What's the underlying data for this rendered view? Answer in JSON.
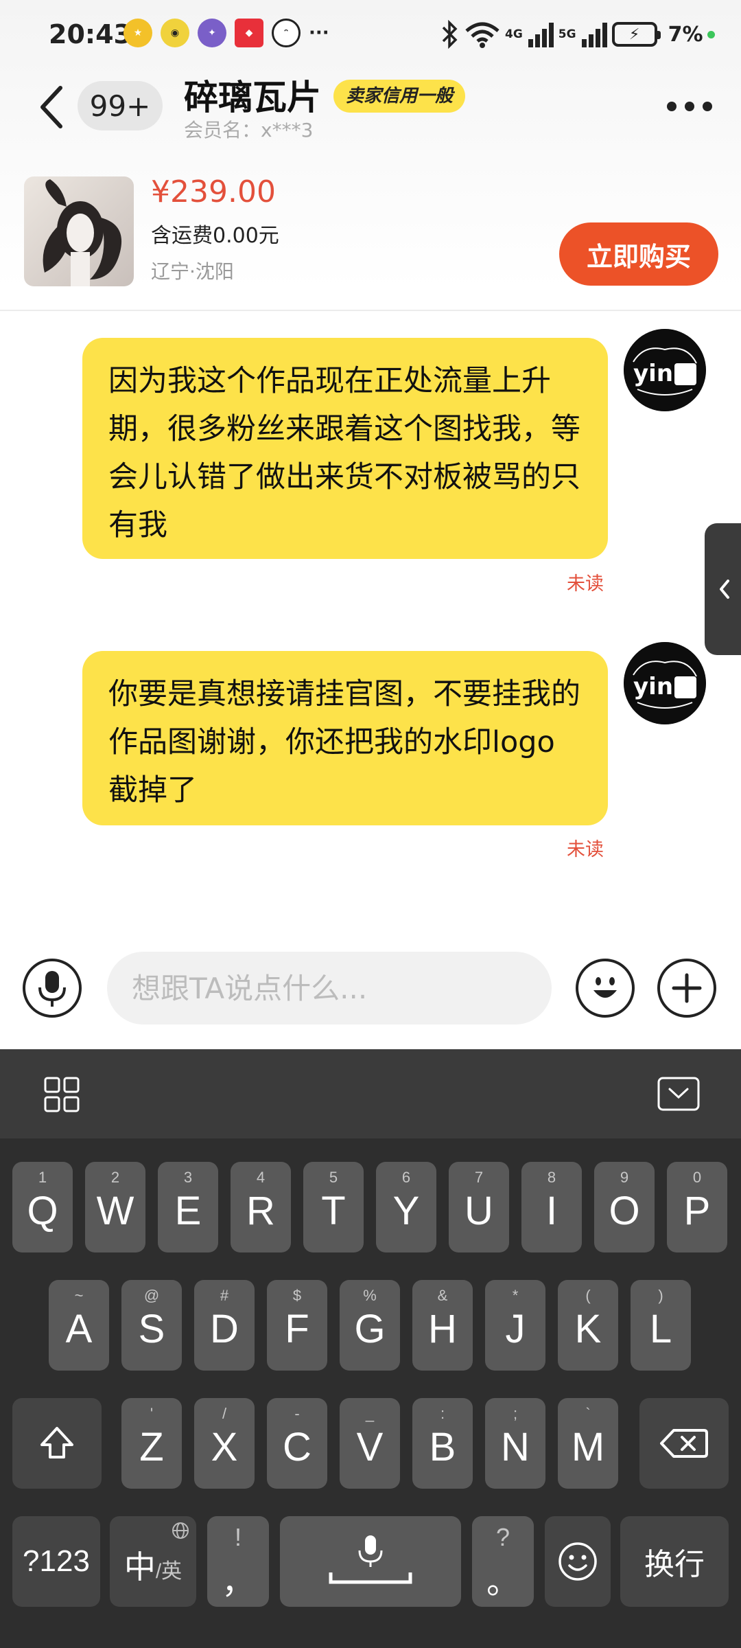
{
  "status_bar": {
    "time": "20:43",
    "more_glyph": "···",
    "signal_4g": "4G",
    "signal_5g": "5G",
    "battery": "7"
  },
  "header": {
    "back_icon": "chevron-left-icon",
    "unread_badge": "99+",
    "shop_name": "碎璃瓦片",
    "credit_badge": "卖家信用一般",
    "member_name": "会员名：x***3"
  },
  "product": {
    "price": "¥239.00",
    "shipping": "含运费0.00元",
    "location": "辽宁·沈阳",
    "buy_button": "立即购买"
  },
  "chat": {
    "messages": [
      {
        "text": "因为我这个作品现在正处流量上升期，很多粉丝来跟着这个图找我，等会儿认错了做出来货不对板被骂的只有我",
        "status": "未读",
        "avatar_text": "yin"
      },
      {
        "text": "你要是真想接请挂官图，不要挂我的作品图谢谢，你还把我的水印logo截掉了",
        "status": "未读",
        "avatar_text": "yin"
      }
    ]
  },
  "input": {
    "placeholder": "想跟TA说点什么..."
  },
  "keyboard": {
    "row1": [
      {
        "main": "Q",
        "hint": "1"
      },
      {
        "main": "W",
        "hint": "2"
      },
      {
        "main": "E",
        "hint": "3"
      },
      {
        "main": "R",
        "hint": "4"
      },
      {
        "main": "T",
        "hint": "5"
      },
      {
        "main": "Y",
        "hint": "6"
      },
      {
        "main": "U",
        "hint": "7"
      },
      {
        "main": "I",
        "hint": "8"
      },
      {
        "main": "O",
        "hint": "9"
      },
      {
        "main": "P",
        "hint": "0"
      }
    ],
    "row2": [
      {
        "main": "A",
        "hint": "~"
      },
      {
        "main": "S",
        "hint": "@"
      },
      {
        "main": "D",
        "hint": "#"
      },
      {
        "main": "F",
        "hint": "$"
      },
      {
        "main": "G",
        "hint": "%"
      },
      {
        "main": "H",
        "hint": "&"
      },
      {
        "main": "J",
        "hint": "*"
      },
      {
        "main": "K",
        "hint": "("
      },
      {
        "main": "L",
        "hint": ")"
      }
    ],
    "row3": [
      {
        "main": "Z",
        "hint": "'"
      },
      {
        "main": "X",
        "hint": "/"
      },
      {
        "main": "C",
        "hint": "-"
      },
      {
        "main": "V",
        "hint": "_"
      },
      {
        "main": "B",
        "hint": ":"
      },
      {
        "main": "N",
        "hint": ";"
      },
      {
        "main": "M",
        "hint": "`"
      }
    ],
    "symbols_key": "?123",
    "lang_key": "中",
    "lang_key_sub": "/英",
    "comma_key": "，",
    "comma_hint": "!",
    "period_key": "。",
    "period_hint": "?",
    "enter_key": "换行"
  },
  "colors": {
    "accent": "#ec5228",
    "bubble": "#fde24a",
    "unread": "#e3503b",
    "keyboard_bg": "#2e2e2e",
    "key_bg": "#595959"
  }
}
